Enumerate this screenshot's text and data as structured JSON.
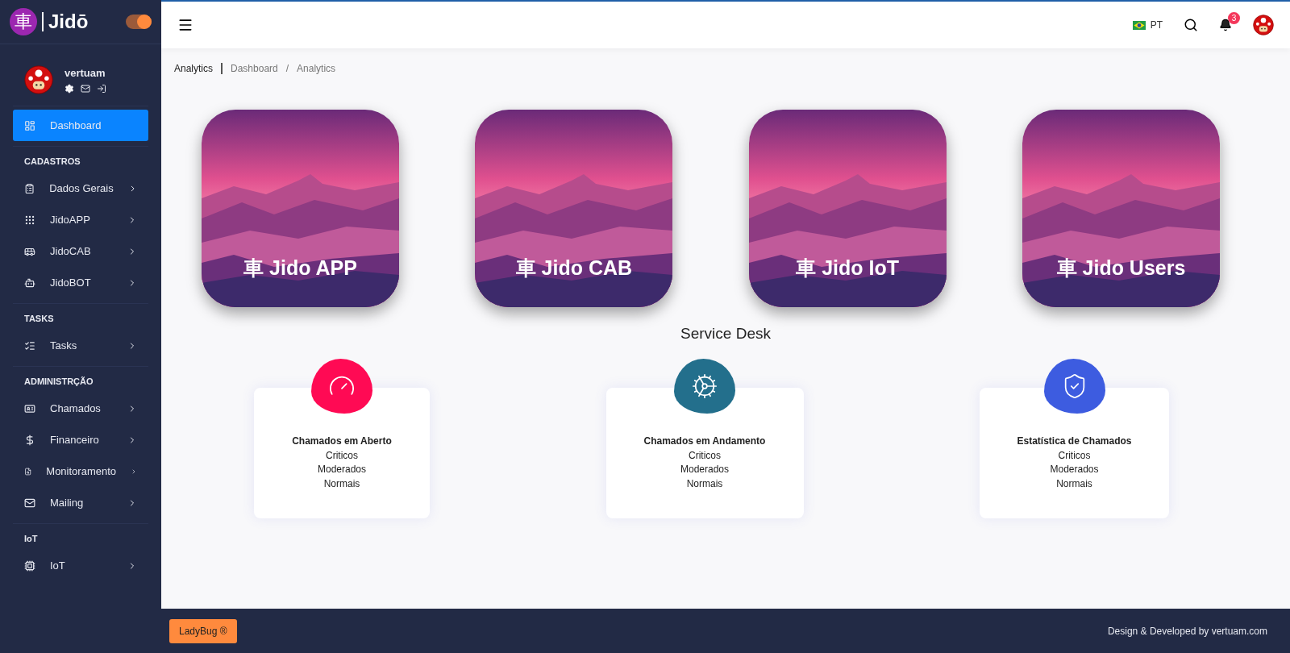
{
  "brand": {
    "logo_glyph": "車",
    "name": "Jidō",
    "theme_toggle_on": true
  },
  "user": {
    "name": "vertuam"
  },
  "sidebar": {
    "sections": [
      {
        "items": [
          {
            "label": "Dashboard",
            "selected": true,
            "expandable": false
          }
        ]
      },
      {
        "title": "CADASTROS",
        "items": [
          {
            "label": "Dados Gerais",
            "selected": false,
            "expandable": true
          },
          {
            "label": "JidoAPP",
            "selected": false,
            "expandable": true
          },
          {
            "label": "JidoCAB",
            "selected": false,
            "expandable": true
          },
          {
            "label": "JidoBOT",
            "selected": false,
            "expandable": true
          }
        ]
      },
      {
        "title": "TASKS",
        "items": [
          {
            "label": "Tasks",
            "selected": false,
            "expandable": true
          }
        ]
      },
      {
        "title": "ADMINISTRÇÃO",
        "items": [
          {
            "label": "Chamados",
            "selected": false,
            "expandable": true
          },
          {
            "label": "Financeiro",
            "selected": false,
            "expandable": true
          },
          {
            "label": "Monitoramento",
            "selected": false,
            "expandable": true
          },
          {
            "label": "Mailing",
            "selected": false,
            "expandable": true
          }
        ]
      },
      {
        "title": "IoT",
        "items": [
          {
            "label": "IoT",
            "selected": false,
            "expandable": true
          }
        ]
      }
    ]
  },
  "header": {
    "language": "PT",
    "notifications": "3"
  },
  "breadcrumb": {
    "title": "Analytics",
    "path": [
      "Dashboard",
      "Analytics"
    ],
    "separator": "/"
  },
  "apps": [
    {
      "glyph": "車",
      "label": "Jido APP"
    },
    {
      "glyph": "車",
      "label": "Jido CAB"
    },
    {
      "glyph": "車",
      "label": "Jido IoT"
    },
    {
      "glyph": "車",
      "label": "Jido Users"
    }
  ],
  "service_desk": {
    "title": "Service Desk",
    "cards": [
      {
        "title": "Chamados em Aberto",
        "lines": [
          "Criticos",
          "Moderados",
          "Normais"
        ],
        "color": "#ff0a54"
      },
      {
        "title": "Chamados em Andamento",
        "lines": [
          "Criticos",
          "Moderados",
          "Normais"
        ],
        "color": "#236f8c"
      },
      {
        "title": "Estatística de Chamados",
        "lines": [
          "Criticos",
          "Moderados",
          "Normais"
        ],
        "color": "#3d5ce0"
      }
    ]
  },
  "footer": {
    "button": "LadyBug ®",
    "credit": "Design & Developed by  vertuam.com"
  }
}
